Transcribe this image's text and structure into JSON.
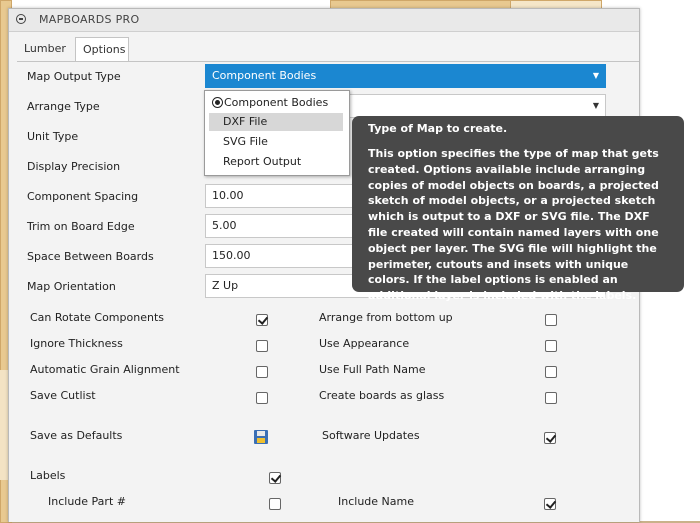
{
  "window": {
    "title": "MAPBOARDS PRO"
  },
  "tabs": [
    {
      "label": "Lumber"
    },
    {
      "label": "Options"
    }
  ],
  "form": {
    "map_output_type": {
      "label": "Map Output Type",
      "value": "Component Bodies"
    },
    "arrange_type": {
      "label": "Arrange Type"
    },
    "unit_type": {
      "label": "Unit Type"
    },
    "display_precision": {
      "label": "Display Precision"
    },
    "component_spacing": {
      "label": "Component Spacing",
      "value": "10.00"
    },
    "trim_on_board_edge": {
      "label": "Trim on Board Edge",
      "value": "5.00"
    },
    "space_between_boards": {
      "label": "Space Between Boards",
      "value": "150.00"
    },
    "map_orientation": {
      "label": "Map Orientation",
      "value": "Z Up"
    }
  },
  "dropdown": {
    "options": [
      "Component Bodies",
      "DXF File",
      "SVG File",
      "Report Output"
    ],
    "selected": "Component Bodies",
    "highlighted": "DXF File"
  },
  "options": {
    "can_rotate": {
      "label": "Can Rotate Components",
      "checked": true
    },
    "arrange_bottom": {
      "label": "Arrange from bottom up",
      "checked": false
    },
    "ignore_thickness": {
      "label": "Ignore Thickness",
      "checked": false
    },
    "use_appearance": {
      "label": "Use Appearance",
      "checked": false
    },
    "auto_grain": {
      "label": "Automatic Grain Alignment",
      "checked": false
    },
    "full_path": {
      "label": "Use Full Path Name",
      "checked": false
    },
    "save_cutlist": {
      "label": "Save Cutlist",
      "checked": false
    },
    "boards_glass": {
      "label": "Create boards as glass",
      "checked": false
    },
    "save_defaults": {
      "label": "Save as Defaults"
    },
    "software_updates": {
      "label": "Software Updates",
      "checked": true
    },
    "labels": {
      "label": "Labels",
      "checked": true
    },
    "include_part": {
      "label": "Include Part #",
      "checked": false
    },
    "include_name": {
      "label": "Include Name",
      "checked": true
    }
  },
  "tooltip": {
    "title": "Type of Map to create.",
    "body": "This option specifies the type of map that gets created. Options available include arranging copies of model objects on boards, a projected sketch of model objects, or a projected sketch which is output to a DXF or SVG file. The DXF file created will contain named layers with one object per layer. The SVG file will highlight the perimeter, cutouts and insets with unique colors. If the label options is enabled an additional layer is included with the labels."
  },
  "icons": {
    "collapse": "collapse-icon",
    "save_defaults": "floppy-disk-icon",
    "radio": "radio-selected-icon",
    "dropdown_arrow": "chevron-down-icon"
  }
}
